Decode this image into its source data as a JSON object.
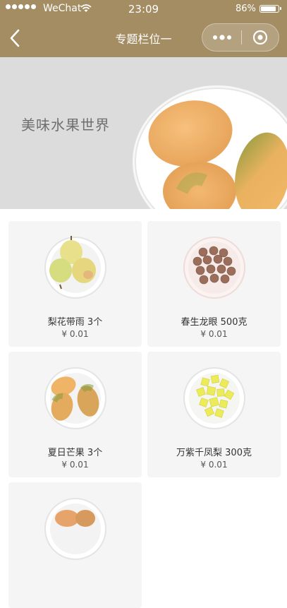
{
  "status_bar": {
    "carrier": "WeChat",
    "time": "23:09",
    "battery": "86%"
  },
  "nav": {
    "title": "专题栏位一"
  },
  "banner": {
    "text": "美味水果世界"
  },
  "products": [
    {
      "name": "梨花带雨 3个",
      "price": "¥ 0.01",
      "icon": "pear-plate"
    },
    {
      "name": "春生龙眼 500克",
      "price": "¥ 0.01",
      "icon": "longan-plate"
    },
    {
      "name": "夏日芒果 3个",
      "price": "¥ 0.01",
      "icon": "mango-plate"
    },
    {
      "name": "万紫千凤梨 300克",
      "price": "¥ 0.01",
      "icon": "pineapple-plate"
    },
    {
      "name": "",
      "price": "",
      "icon": "mango-plate"
    }
  ],
  "colors": {
    "nav_bg": "#a48d63",
    "banner_bg": "#dcdcdd",
    "card_bg": "#f5f5f5"
  }
}
